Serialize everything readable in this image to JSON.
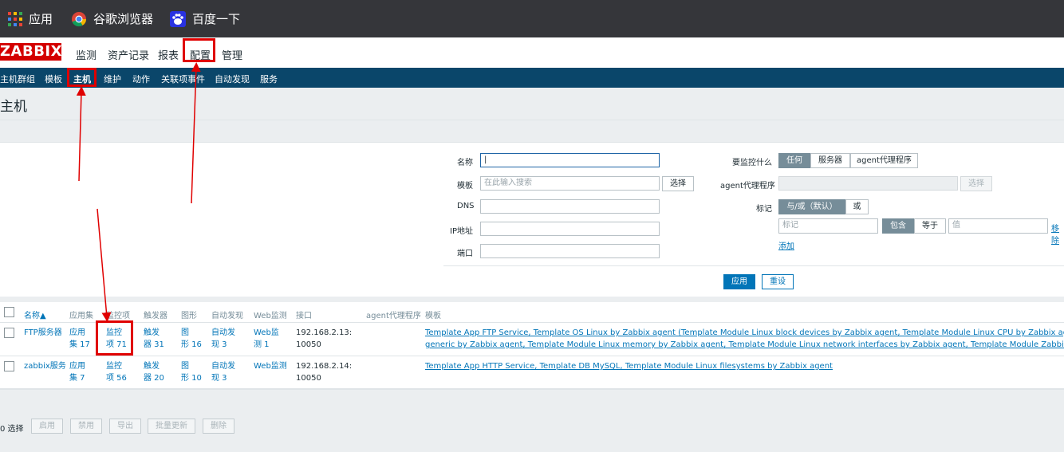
{
  "bookmarks": {
    "apps": "应用",
    "chrome": "谷歌浏览器",
    "baidu": "百度一下"
  },
  "brand": {
    "logo": "ZABBIX",
    "color": "#d40000"
  },
  "topnav": [
    "监测",
    "资产记录",
    "报表",
    "配置",
    "管理"
  ],
  "subnav": [
    "主机群组",
    "模板",
    "主机",
    "维护",
    "动作",
    "关联项事件",
    "自动发现",
    "服务"
  ],
  "page": {
    "title": "主机"
  },
  "filter": {
    "name_label": "名称",
    "template_label": "模板",
    "template_placeholder": "在此输入搜索",
    "select": "选择",
    "dns_label": "DNS",
    "ip_label": "IP地址",
    "port_label": "端口",
    "monitored_by_label": "要监控什么",
    "monitored_by": [
      "任何",
      "服务器",
      "agent代理程序"
    ],
    "proxy_label": "agent代理程序",
    "proxy_select": "选择",
    "tags_label": "标记",
    "tags_mode": [
      "与/或（默认）",
      "或"
    ],
    "tag_placeholder": "标记",
    "tag_ops": [
      "包含",
      "等于"
    ],
    "value_placeholder": "值",
    "remove": "移除",
    "add": "添加",
    "apply": "应用",
    "reset": "重设"
  },
  "table": {
    "headers": [
      "名称▲",
      "应用集",
      "监控项",
      "触发器",
      "图形",
      "自动发现",
      "Web监测",
      "接口",
      "agent代理程序",
      "模板"
    ],
    "rows": [
      {
        "name": "FTP服务器",
        "apps": [
          "应用",
          "集 17"
        ],
        "items": [
          "监控",
          "项 71"
        ],
        "triggers": [
          "触发",
          "器 31"
        ],
        "graphs": [
          "图",
          "形 16"
        ],
        "discovery": [
          "自动发",
          "现 3"
        ],
        "web": [
          "Web监",
          "测 1"
        ],
        "iface": [
          "192.168.2.13:",
          "10050"
        ],
        "templates": [
          "Template App FTP Service, Template OS Linux by Zabbix agent (Template Module Linux block devices by Zabbix agent, Template Module Linux CPU by Zabbix agent, Template Module",
          "generic by Zabbix agent, Template Module Linux memory by Zabbix agent, Template Module Linux network interfaces by Zabbix agent, Template Module Zabbix agent)"
        ]
      },
      {
        "name": "zabbix服务",
        "apps": [
          "应用",
          "集 7"
        ],
        "items": [
          "监控",
          "项 56"
        ],
        "triggers": [
          "触发",
          "器 20"
        ],
        "graphs": [
          "图",
          "形 10"
        ],
        "discovery": [
          "自动发",
          "现 3"
        ],
        "web": [
          "Web监测",
          ""
        ],
        "iface": [
          "192.168.2.14:",
          "10050"
        ],
        "templates": [
          "Template App HTTP Service, Template DB MySQL, Template Module Linux filesystems by Zabbix agent",
          ""
        ]
      }
    ]
  },
  "footer": {
    "count": "0 选择",
    "buttons": [
      "启用",
      "禁用",
      "导出",
      "批量更新",
      "删除"
    ]
  },
  "colors": {
    "accent": "#0275b8",
    "subnav": "#0a466a",
    "highlight": "#e00000"
  }
}
